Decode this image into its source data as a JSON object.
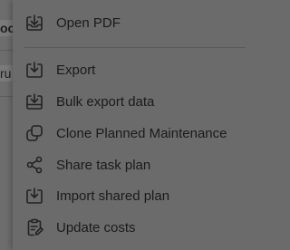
{
  "background": {
    "row1_fragment": "oc",
    "row2_fragment": "ru"
  },
  "menu": {
    "items": [
      {
        "label": "Open PDF",
        "icon": "open-pdf-icon"
      },
      {
        "label": "Export",
        "icon": "export-icon"
      },
      {
        "label": "Bulk export data",
        "icon": "bulk-export-icon"
      },
      {
        "label": "Clone Planned Maintenance",
        "icon": "clone-icon"
      },
      {
        "label": "Share task plan",
        "icon": "share-icon"
      },
      {
        "label": "Import shared plan",
        "icon": "import-icon"
      },
      {
        "label": "Update costs",
        "icon": "update-costs-icon"
      }
    ]
  },
  "colors": {
    "overlay": "#6b6b6b",
    "text": "#1b1b1b",
    "icon": "#222222"
  }
}
